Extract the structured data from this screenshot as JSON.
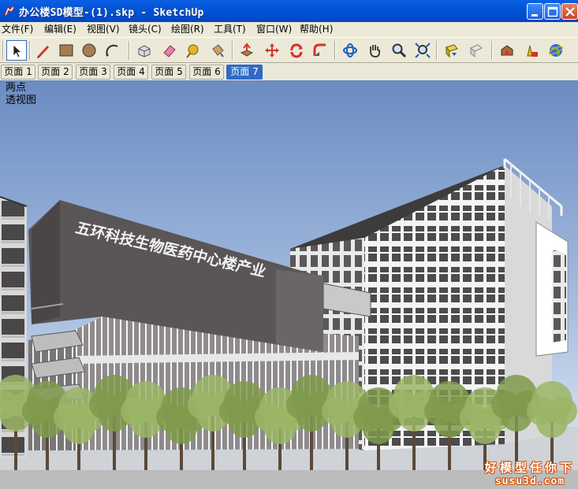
{
  "window": {
    "title": "办公楼SD模型-(1).skp - SketchUp",
    "controls": [
      "minimize",
      "maximize",
      "close"
    ]
  },
  "menu": {
    "items": [
      "文件(F)",
      "编辑(E)",
      "视图(V)",
      "镜头(C)",
      "绘图(R)",
      "工具(T)",
      "窗口(W)",
      "帮助(H)"
    ]
  },
  "toolbar": {
    "tools": [
      {
        "icon": "select-arrow-icon"
      },
      {
        "icon": "pencil-line-icon"
      },
      {
        "icon": "rectangle-icon"
      },
      {
        "icon": "circle-icon"
      },
      {
        "icon": "arc-icon"
      },
      {
        "icon": "make-component-icon"
      },
      {
        "icon": "eraser-icon"
      },
      {
        "icon": "tape-measure-icon"
      },
      {
        "icon": "paint-bucket-icon"
      },
      {
        "icon": "push-pull-icon"
      },
      {
        "icon": "move-icon"
      },
      {
        "icon": "rotate-icon"
      },
      {
        "icon": "follow-me-icon"
      },
      {
        "icon": "orbit-icon"
      },
      {
        "icon": "pan-hand-icon"
      },
      {
        "icon": "zoom-icon"
      },
      {
        "icon": "zoom-extents-icon"
      },
      {
        "icon": "get-models-icon"
      },
      {
        "icon": "share-model-icon"
      },
      {
        "icon": "component-warehouse-icon"
      },
      {
        "icon": "add-location-icon"
      },
      {
        "icon": "google-earth-icon"
      }
    ],
    "active_tool": "select-arrow-icon"
  },
  "tabs": {
    "items": [
      "页面 1",
      "页面 2",
      "页面 3",
      "页面 4",
      "页面 5",
      "页面 6",
      "页面 7"
    ],
    "selected": "页面 7"
  },
  "viewport": {
    "view_label_line1": "两点",
    "view_label_line2": "透视图",
    "building_sign": "五环科技生物医药中心楼产业"
  },
  "watermark": {
    "line1": "好模型任你下",
    "line2": "susu3d.com"
  },
  "colors": {
    "titlebar": "#0054e3",
    "selected_tab": "#316ac5",
    "sky_top": "#6b8cc2",
    "sky_bottom": "#e6edf7",
    "facade_dark": "#5a5556",
    "watermark": "#d24b00"
  }
}
